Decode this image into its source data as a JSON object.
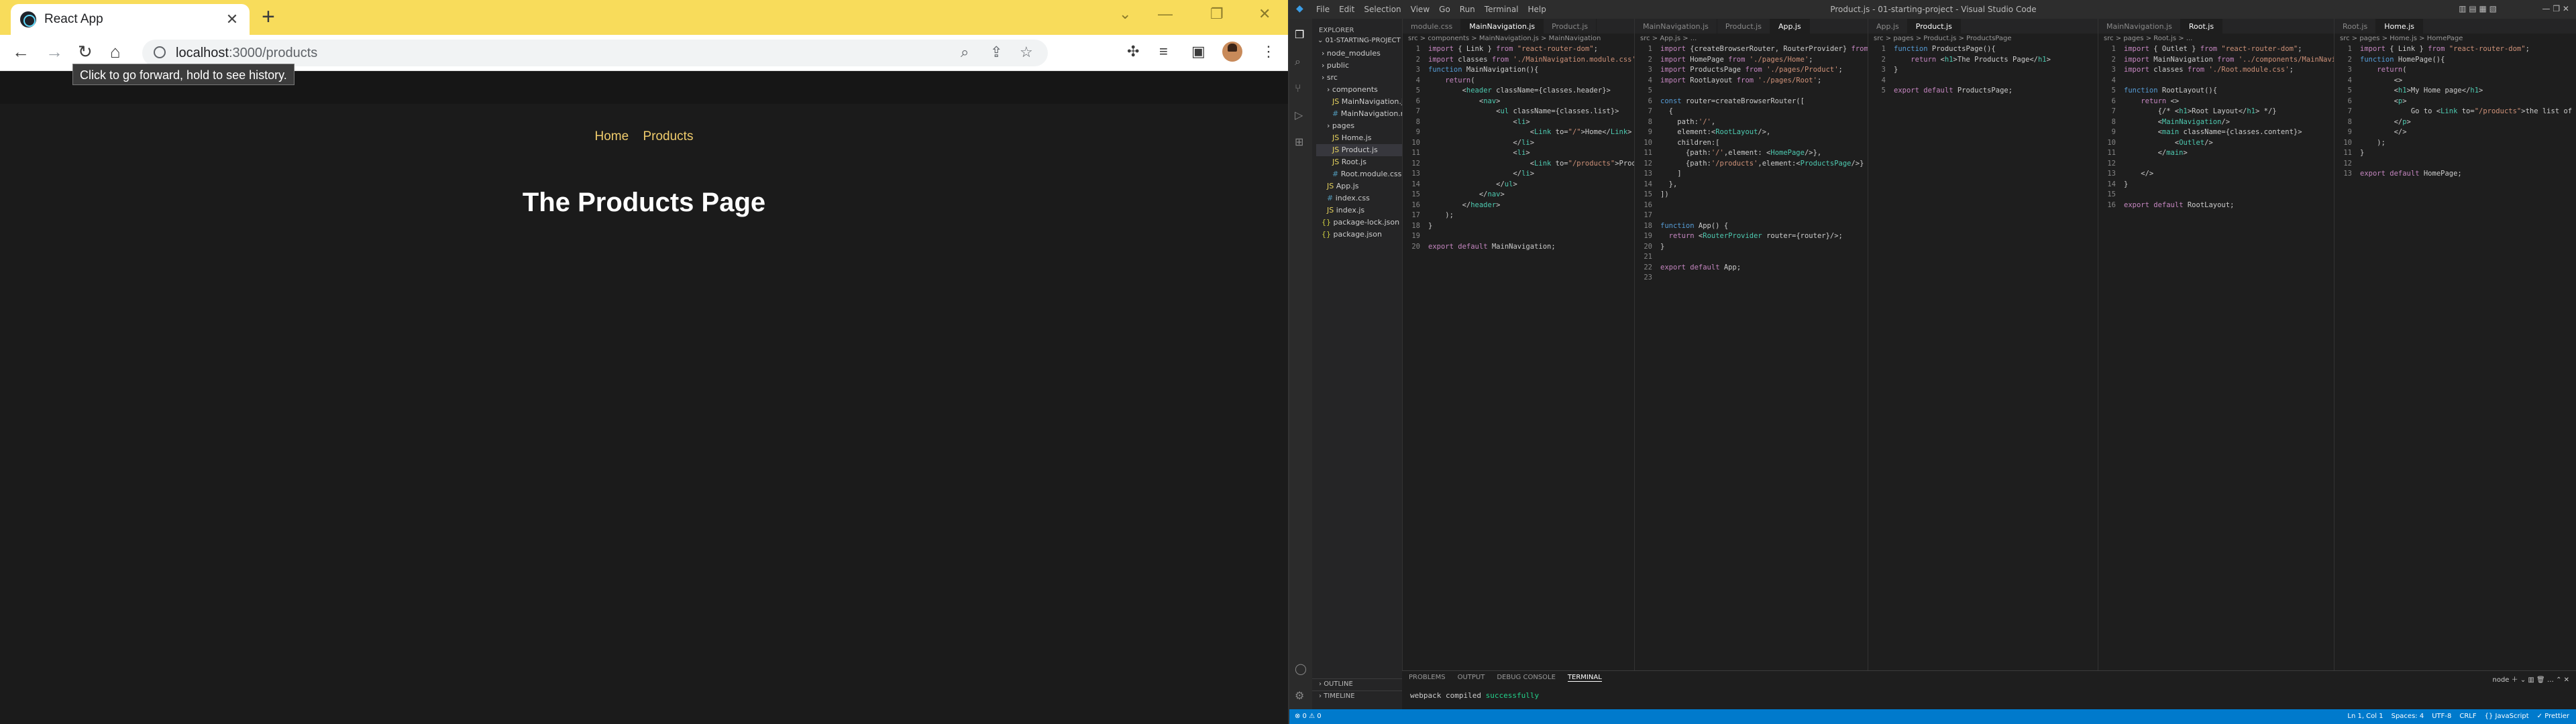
{
  "browser": {
    "tab_title": "React App",
    "url_host": "localhost",
    "url_path": ":3000/products",
    "tooltip": "Click to go forward, hold to see history."
  },
  "app": {
    "nav": [
      "Home",
      "Products"
    ],
    "heading": "The Products Page"
  },
  "vscode": {
    "menu": [
      "File",
      "Edit",
      "Selection",
      "View",
      "Go",
      "Run",
      "Terminal",
      "Help"
    ],
    "window_title": "Product.js - 01-starting-project - Visual Studio Code",
    "explorer_label": "EXPLORER",
    "project": "01-STARTING-PROJECT",
    "tree": [
      {
        "name": "node_modules",
        "kind": "folder",
        "level": 1
      },
      {
        "name": "public",
        "kind": "folder",
        "level": 1
      },
      {
        "name": "src",
        "kind": "folder",
        "level": 1
      },
      {
        "name": "components",
        "kind": "folder",
        "level": 2
      },
      {
        "name": "MainNavigation.js",
        "kind": "js",
        "level": 3
      },
      {
        "name": "MainNavigation.m...",
        "kind": "css",
        "level": 3
      },
      {
        "name": "pages",
        "kind": "folder",
        "level": 2
      },
      {
        "name": "Home.js",
        "kind": "js",
        "level": 3
      },
      {
        "name": "Product.js",
        "kind": "js",
        "level": 3,
        "selected": true
      },
      {
        "name": "Root.js",
        "kind": "js",
        "level": 3
      },
      {
        "name": "Root.module.css",
        "kind": "css",
        "level": 3
      },
      {
        "name": "App.js",
        "kind": "js",
        "level": 2
      },
      {
        "name": "index.css",
        "kind": "css",
        "level": 2
      },
      {
        "name": "index.js",
        "kind": "js",
        "level": 2
      },
      {
        "name": "package-lock.json",
        "kind": "json",
        "level": 1
      },
      {
        "name": "package.json",
        "kind": "json",
        "level": 1
      }
    ],
    "outline": "OUTLINE",
    "timeline": "TIMELINE",
    "groups": [
      {
        "tabs": [
          "module.css",
          "MainNavigation.js",
          "Product.js"
        ],
        "active": 1,
        "crumb": "src > components > MainNavigation.js > MainNavigation",
        "lines": [
          "import { Link } from \"react-router-dom\";",
          "import classes from './MainNavigation.module.css';",
          "function MainNavigation(){",
          "    return(",
          "        <header className={classes.header}>",
          "            <nav>",
          "                <ul className={classes.list}>",
          "                    <li>",
          "                        <Link to=\"/\">Home</Link>",
          "                    </li>",
          "                    <li>",
          "                        <Link to=\"/products\">Products</Link>",
          "                    </li>",
          "                </ul>",
          "            </nav>",
          "        </header>",
          "    );",
          "}",
          "",
          "export default MainNavigation;"
        ]
      },
      {
        "tabs": [
          "MainNavigation.js",
          "Product.js",
          "App.js"
        ],
        "active": 2,
        "crumb": "src > App.js > ...",
        "lines": [
          "import {createBrowserRouter, RouterProvider} from 'react-router-dom';",
          "import HomePage from './pages/Home';",
          "import ProductsPage from './pages/Product';",
          "import RootLayout from './pages/Root';",
          "",
          "const router=createBrowserRouter([",
          "  {",
          "    path:'/',",
          "    element:<RootLayout/>,",
          "    children:[",
          "      {path:'/',element: <HomePage/>},",
          "      {path:'/products',element:<ProductsPage/>}",
          "    ]",
          "  },",
          "])",
          "",
          "",
          "function App() {",
          "  return <RouterProvider router={router}/>;",
          "}",
          "",
          "export default App;",
          ""
        ]
      },
      {
        "tabs": [
          "App.js",
          "Product.js"
        ],
        "active": 1,
        "crumb": "src > pages > Product.js > ProductsPage",
        "lines": [
          "function ProductsPage(){",
          "    return <h1>The Products Page</h1>",
          "}",
          "",
          "export default ProductsPage;"
        ]
      },
      {
        "tabs": [
          "MainNavigation.js",
          "Root.js"
        ],
        "active": 1,
        "crumb": "src > pages > Root.js > ...",
        "lines": [
          "import { Outlet } from \"react-router-dom\";",
          "import MainNavigation from '../components/MainNavigation';",
          "import classes from './Root.module.css';",
          "",
          "function RootLayout(){",
          "    return <>",
          "        {/* <h1>Root Layout</h1> */}",
          "        <MainNavigation/>",
          "        <main className={classes.content}>",
          "            <Outlet/>",
          "        </main>",
          "",
          "    </>",
          "}",
          "",
          "export default RootLayout;"
        ]
      },
      {
        "tabs": [
          "Root.js",
          "Home.js"
        ],
        "active": 1,
        "crumb": "src > pages > Home.js > HomePage",
        "lines": [
          "import { Link } from \"react-router-dom\";",
          "function HomePage(){",
          "    return(",
          "        <>",
          "        <h1>My Home page</h1>",
          "        <p>",
          "            Go to <Link to=\"/products\">the list of products</Link>",
          "        </p>",
          "        </>",
          "    );",
          "}",
          "",
          "export default HomePage;"
        ]
      }
    ],
    "panel_tabs": [
      "PROBLEMS",
      "OUTPUT",
      "DEBUG CONSOLE",
      "TERMINAL"
    ],
    "terminal_text": "webpack compiled",
    "terminal_ok": "successfully",
    "terminal_label": "node",
    "status_left": "⊗ 0 ⚠ 0",
    "status_right": [
      "Ln 1, Col 1",
      "Spaces: 4",
      "UTF-8",
      "CRLF",
      "{} JavaScript",
      "✓ Prettier"
    ]
  }
}
